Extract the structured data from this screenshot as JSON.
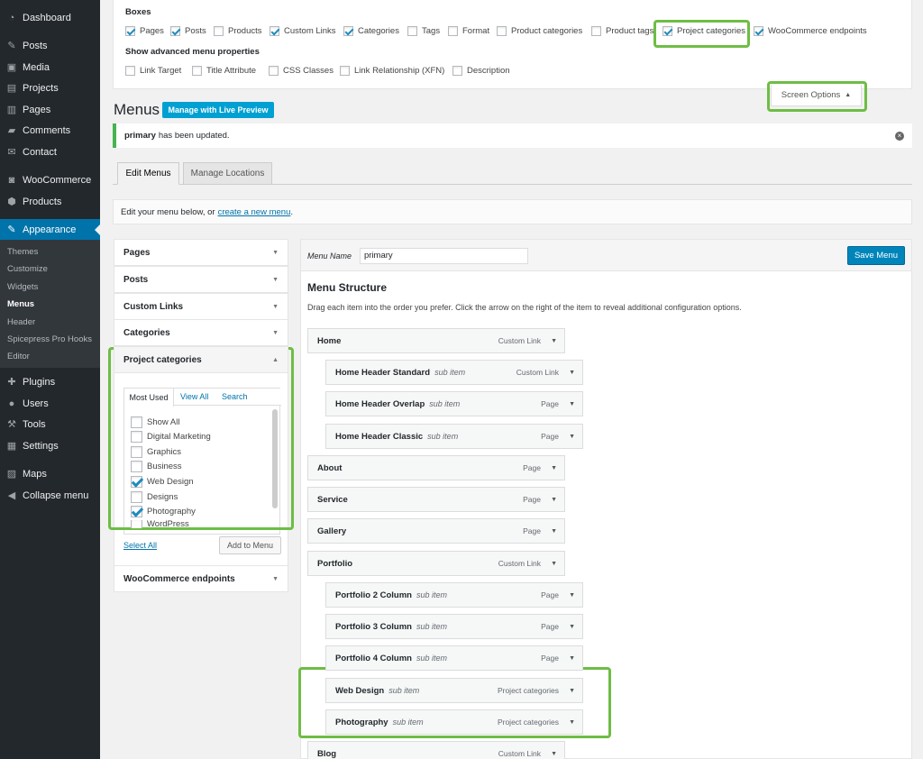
{
  "sidebar": {
    "items": [
      {
        "label": "Dashboard",
        "icon": "dashboard-icon",
        "glyph": "◔"
      },
      {
        "label": "Posts",
        "icon": "pin-icon",
        "glyph": "✎"
      },
      {
        "label": "Media",
        "icon": "media-icon",
        "glyph": "▣"
      },
      {
        "label": "Projects",
        "icon": "projects-icon",
        "glyph": "▤"
      },
      {
        "label": "Pages",
        "icon": "pages-icon",
        "glyph": "▥"
      },
      {
        "label": "Comments",
        "icon": "comments-icon",
        "glyph": "▰"
      },
      {
        "label": "Contact",
        "icon": "mail-icon",
        "glyph": "✉"
      },
      {
        "label": "WooCommerce",
        "icon": "woo-icon",
        "glyph": "◙"
      },
      {
        "label": "Products",
        "icon": "products-icon",
        "glyph": "⬢"
      },
      {
        "label": "Appearance",
        "icon": "brush-icon",
        "glyph": "✎"
      },
      {
        "label": "Plugins",
        "icon": "plugin-icon",
        "glyph": "✚"
      },
      {
        "label": "Users",
        "icon": "users-icon",
        "glyph": "●"
      },
      {
        "label": "Tools",
        "icon": "wrench-icon",
        "glyph": "⚒"
      },
      {
        "label": "Settings",
        "icon": "settings-icon",
        "glyph": "▦"
      },
      {
        "label": "Maps",
        "icon": "maps-icon",
        "glyph": "▨"
      },
      {
        "label": "Collapse menu",
        "icon": "collapse-icon",
        "glyph": "◀"
      }
    ],
    "submenu": [
      "Themes",
      "Customize",
      "Widgets",
      "Menus",
      "Header",
      "Spicepress Pro Hooks",
      "Editor"
    ]
  },
  "screen_options": {
    "boxes_heading": "Boxes",
    "boxes": [
      {
        "label": "Pages",
        "checked": true
      },
      {
        "label": "Posts",
        "checked": true
      },
      {
        "label": "Products",
        "checked": false
      },
      {
        "label": "Custom Links",
        "checked": true
      },
      {
        "label": "Categories",
        "checked": true
      },
      {
        "label": "Tags",
        "checked": false
      },
      {
        "label": "Format",
        "checked": false
      },
      {
        "label": "Product categories",
        "checked": false
      },
      {
        "label": "Product tags",
        "checked": false
      },
      {
        "label": "Project categories",
        "checked": true
      },
      {
        "label": "WooCommerce endpoints",
        "checked": true
      }
    ],
    "advanced_heading": "Show advanced menu properties",
    "advanced": [
      {
        "label": "Link Target",
        "checked": false
      },
      {
        "label": "Title Attribute",
        "checked": false
      },
      {
        "label": "CSS Classes",
        "checked": false
      },
      {
        "label": "Link Relationship (XFN)",
        "checked": false
      },
      {
        "label": "Description",
        "checked": false
      }
    ],
    "toggle_label": "Screen Options"
  },
  "page": {
    "title": "Menus",
    "live_preview_label": "Manage with Live Preview",
    "notice_bold": "primary",
    "notice_text": "has been updated.",
    "tabs": [
      "Edit Menus",
      "Manage Locations"
    ],
    "info_text": "Edit your menu below, or",
    "info_link": "create a new menu",
    "info_end": "."
  },
  "accordion": {
    "sections": [
      "Pages",
      "Posts",
      "Custom Links",
      "Categories",
      "Project categories",
      "WooCommerce endpoints"
    ],
    "inner_tabs": [
      "Most Used",
      "View All",
      "Search"
    ],
    "categories": [
      {
        "label": "Show All",
        "checked": false
      },
      {
        "label": "Digital Marketing",
        "checked": false
      },
      {
        "label": "Graphics",
        "checked": false
      },
      {
        "label": "Business",
        "checked": false
      },
      {
        "label": "Web Design",
        "checked": true
      },
      {
        "label": "Designs",
        "checked": false
      },
      {
        "label": "Photography",
        "checked": true
      },
      {
        "label": "WordPress",
        "checked": false
      }
    ],
    "select_all": "Select All",
    "add_to_menu": "Add to Menu"
  },
  "menu_editor": {
    "name_label": "Menu Name",
    "name_value": "primary",
    "save_label": "Save Menu",
    "structure_heading": "Menu Structure",
    "structure_desc": "Drag each item into the order you prefer. Click the arrow on the right of the item to reveal additional configuration options.",
    "sub_item_label": "sub item",
    "items": [
      {
        "title": "Home",
        "type": "Custom Link",
        "sub": false
      },
      {
        "title": "Home Header Standard",
        "type": "Custom Link",
        "sub": true
      },
      {
        "title": "Home Header Overlap",
        "type": "Page",
        "sub": true
      },
      {
        "title": "Home Header Classic",
        "type": "Page",
        "sub": true
      },
      {
        "title": "About",
        "type": "Page",
        "sub": false
      },
      {
        "title": "Service",
        "type": "Page",
        "sub": false
      },
      {
        "title": "Gallery",
        "type": "Page",
        "sub": false
      },
      {
        "title": "Portfolio",
        "type": "Custom Link",
        "sub": false
      },
      {
        "title": "Portfolio 2 Column",
        "type": "Page",
        "sub": true
      },
      {
        "title": "Portfolio 3 Column",
        "type": "Page",
        "sub": true
      },
      {
        "title": "Portfolio 4 Column",
        "type": "Page",
        "sub": true
      },
      {
        "title": "Web Design",
        "type": "Project categories",
        "sub": true
      },
      {
        "title": "Photography",
        "type": "Project categories",
        "sub": true
      },
      {
        "title": "Blog",
        "type": "Custom Link",
        "sub": false
      }
    ]
  },
  "colors": {
    "accent": "#0073aa",
    "highlight": "#6ebd44",
    "sidebar": "#23282d"
  }
}
